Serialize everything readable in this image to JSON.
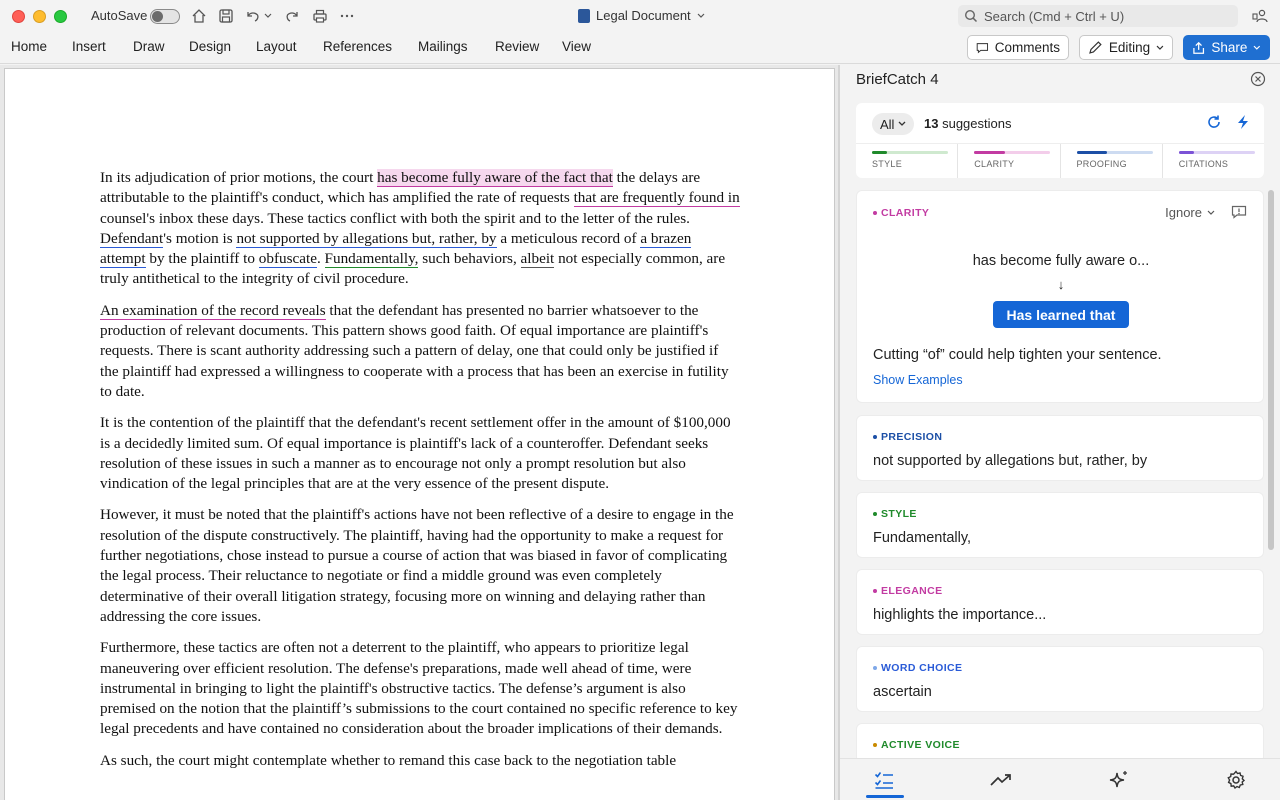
{
  "titlebar": {
    "autosave_label": "AutoSave",
    "document_title": "Legal Document",
    "search_placeholder": "Search (Cmd + Ctrl + U)"
  },
  "ribbon": {
    "tabs": [
      "Home",
      "Insert",
      "Draw",
      "Design",
      "Layout",
      "References",
      "Mailings",
      "Review",
      "View"
    ],
    "comments_label": "Comments",
    "editing_label": "Editing",
    "share_label": "Share"
  },
  "document": {
    "p1": {
      "a": "In its adjudication of prior motions, the court ",
      "b": "has become fully aware of the fact that",
      "c": " the delays are attributable to the plaintiff's conduct, which has amplified the rate of requests ",
      "d": "that are frequently found in",
      "e": " counsel's inbox these days. These tactics conflict with both the spirit and to the letter of the rules. ",
      "f": "Defendant",
      "g": "'s motion is ",
      "h": "not supported by allegations but, rather, by",
      "i": " a meticulous record of ",
      "j": "a brazen attempt",
      "k": " by the plaintiff to ",
      "l": "obfuscate",
      "m": ". ",
      "n": "Fundamentally,",
      "o": " such behaviors, ",
      "p": "albeit",
      "q": " not especially common, are truly antithetical to the integrity of civil procedure."
    },
    "p2": {
      "a": "An examination of the record reveals",
      "b": " that the defendant has presented no barrier whatsoever to the production of relevant documents. This pattern shows good faith. Of equal importance are plaintiff's requests. There is scant authority addressing such a pattern of delay, one that could only be justified if the plaintiff had expressed a willingness to cooperate with a process that has been an exercise in futility to date."
    },
    "p3": "It is the contention of the plaintiff that the defendant's recent settlement offer in the amount of $100,000 is a decidedly limited sum. Of equal importance is plaintiff's lack of a counteroffer. Defendant seeks resolution of these issues in such a manner as to encourage not only a prompt resolution but also vindication of the legal principles that are at the very essence of the present dispute.",
    "p4": "However, it must be noted that the plaintiff's actions have not been reflective of a desire to engage in the resolution of the dispute constructively. The plaintiff, having had the opportunity to make a request for further negotiations, chose instead to pursue a course of action that was biased in favor of complicating the legal process. Their reluctance to negotiate or find a middle ground was even completely determinative of their overall litigation strategy, focusing more on winning and delaying rather than addressing the core issues.",
    "p5": "Furthermore, these tactics are often not a deterrent to the plaintiff, who appears to prioritize legal maneuvering over efficient resolution. The defense's preparations, made well ahead of time, were instrumental in bringing to light the plaintiff's obstructive tactics. The defense’s argument is also premised on the notion that the plaintiff’s submissions to the court contained no specific reference to key legal precedents and have contained no consideration about the broader implications of their demands.",
    "p6": "As such, the court might contemplate whether to remand this case back to the negotiation table"
  },
  "panel": {
    "title": "BriefCatch 4",
    "filter": "All",
    "suggestion_count": "13",
    "suggestion_word": "suggestions",
    "categories": [
      {
        "label": "STYLE",
        "color": "#1f8a2b",
        "track": "#cfe9cf",
        "progress": 0.2
      },
      {
        "label": "CLARITY",
        "color": "#c23ba2",
        "track": "#f3cdea",
        "progress": 0.4
      },
      {
        "label": "PROOFING",
        "color": "#1c4fa6",
        "track": "#cddbf1",
        "progress": 0.4
      },
      {
        "label": "CITATIONS",
        "color": "#7b52d6",
        "track": "#ddd2f5",
        "progress": 0.2
      }
    ],
    "active_card": {
      "tag": "CLARITY",
      "ignore_label": "Ignore",
      "original": "has become fully aware o...",
      "arrow": "↓",
      "replacement": "Has learned that",
      "explanation": "Cutting “of” could help tighten your sentence.",
      "examples_link": "Show Examples"
    },
    "cards": [
      {
        "tag": "PRECISION",
        "text": "not supported by allegations but, rather, by",
        "color": "#1c4fa6"
      },
      {
        "tag": "STYLE",
        "text": "Fundamentally,",
        "color": "#1f8a2b"
      },
      {
        "tag": "ELEGANCE",
        "text": "highlights the importance...",
        "color": "#c23ba2"
      },
      {
        "tag": "WORD CHOICE",
        "text": "ascertain",
        "color": "#2a5bd7"
      },
      {
        "tag": "ACTIVE VOICE",
        "text": "",
        "color": "#c98a00"
      }
    ]
  },
  "colors": {
    "accent": "#1566d6",
    "clarity": "#c23ba2",
    "style": "#1f8a2b"
  }
}
